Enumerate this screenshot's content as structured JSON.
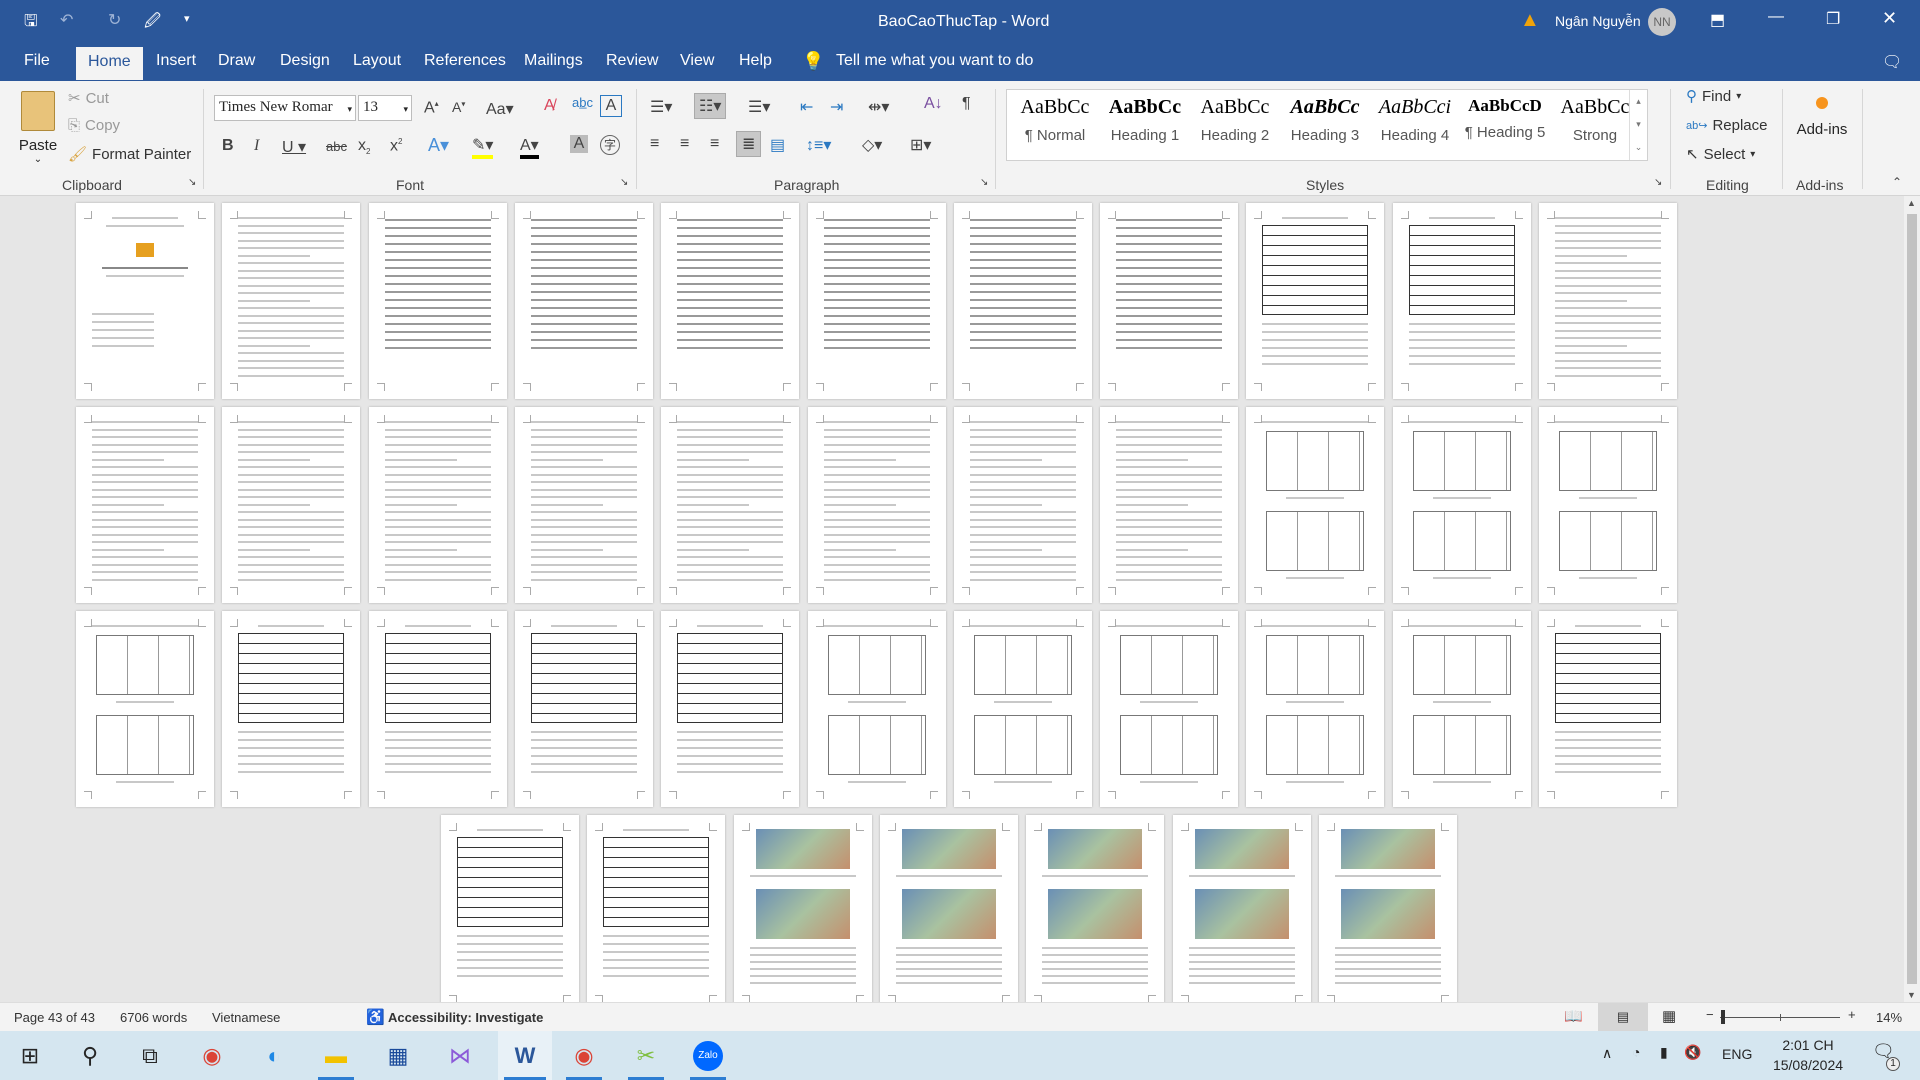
{
  "titlebar": {
    "doc_title": "BaoCaoThucTap",
    "separator": "-",
    "app": "Word",
    "user": "Ngân Nguyễn",
    "initials": "NN"
  },
  "tabs": [
    {
      "label": "File"
    },
    {
      "label": "Home",
      "active": true
    },
    {
      "label": "Insert"
    },
    {
      "label": "Draw"
    },
    {
      "label": "Design"
    },
    {
      "label": "Layout"
    },
    {
      "label": "References"
    },
    {
      "label": "Mailings"
    },
    {
      "label": "Review"
    },
    {
      "label": "View"
    },
    {
      "label": "Help"
    }
  ],
  "tell_me": "Tell me what you want to do",
  "clipboard": {
    "paste": "Paste",
    "cut": "Cut",
    "copy": "Copy",
    "format_painter": "Format Painter",
    "label": "Clipboard"
  },
  "font": {
    "name": "Times New Romar",
    "size": "13",
    "label": "Font",
    "highlight_color": "#ffff00",
    "font_color": "#000000"
  },
  "paragraph": {
    "label": "Paragraph"
  },
  "styles": {
    "label": "Styles",
    "items": [
      {
        "preview": "AaBbCc",
        "name": "¶ Normal"
      },
      {
        "preview": "AaBbCc",
        "name": "Heading 1"
      },
      {
        "preview": "AaBbCc",
        "name": "Heading 2"
      },
      {
        "preview": "AaBbCc",
        "name": "Heading 3"
      },
      {
        "preview": "AaBbCci",
        "name": "Heading 4"
      },
      {
        "preview": "AaBbCcD",
        "name": "¶ Heading 5"
      },
      {
        "preview": "AaBbCc",
        "name": "Strong"
      }
    ]
  },
  "editing": {
    "find": "Find",
    "replace": "Replace",
    "select": "Select",
    "label": "Editing"
  },
  "addins": {
    "button": "Add-ins",
    "label": "Add-ins"
  },
  "status": {
    "page": "Page 43 of 43",
    "words": "6706 words",
    "language": "Vietnamese",
    "accessibility": "Accessibility: Investigate",
    "zoom": "14%",
    "zoom_percent": 14
  },
  "taskbar": {
    "time": "2:01 CH",
    "date": "15/08/2024",
    "lang": "ENG",
    "notifications": "1"
  },
  "colors": {
    "brand": "#2b579a",
    "warning": "#f0a30a"
  }
}
